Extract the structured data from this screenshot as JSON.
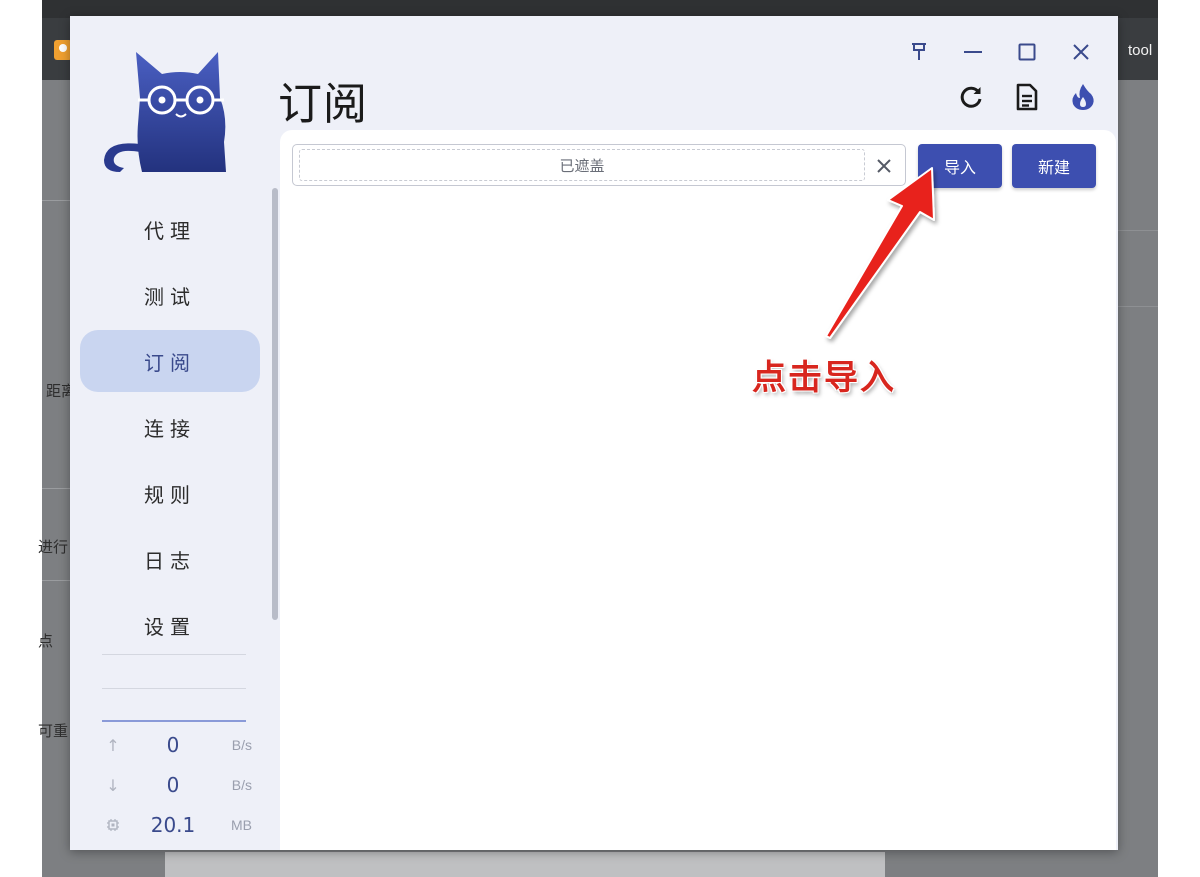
{
  "background_app": {
    "toolbar_text": "tool",
    "sidebar_fragments": [
      "距离",
      "进行",
      "点",
      "可重"
    ]
  },
  "window": {
    "title": "订阅",
    "controls": {
      "pin_icon": "pin-icon",
      "minimize_icon": "minimize-icon",
      "maximize_icon": "maximize-icon",
      "close_icon": "close-icon"
    },
    "header_actions": [
      {
        "icon": "refresh-icon"
      },
      {
        "icon": "document-icon"
      },
      {
        "icon": "flame-icon"
      }
    ]
  },
  "sidebar": {
    "items": [
      {
        "label": "代理",
        "active": false
      },
      {
        "label": "测试",
        "active": false
      },
      {
        "label": "订阅",
        "active": true
      },
      {
        "label": "连接",
        "active": false
      },
      {
        "label": "规则",
        "active": false
      },
      {
        "label": "日志",
        "active": false
      },
      {
        "label": "设置",
        "active": false
      }
    ],
    "traffic": {
      "upload": {
        "value": "0",
        "unit": "B/s",
        "icon": "arrow-up-icon"
      },
      "download": {
        "value": "0",
        "unit": "B/s",
        "icon": "arrow-down-icon"
      },
      "memory": {
        "value": "20.1",
        "unit": "MB",
        "icon": "chip-icon"
      }
    }
  },
  "main": {
    "url_input": {
      "value": "已遮盖"
    },
    "import_label": "导入",
    "new_label": "新建"
  },
  "annotation": {
    "text": "点击导入"
  },
  "colors": {
    "primary": "#3d4fb0",
    "active_nav_bg": "#c9d5f0",
    "annotation_red": "#d8261e",
    "window_bg": "#eef0f8"
  }
}
